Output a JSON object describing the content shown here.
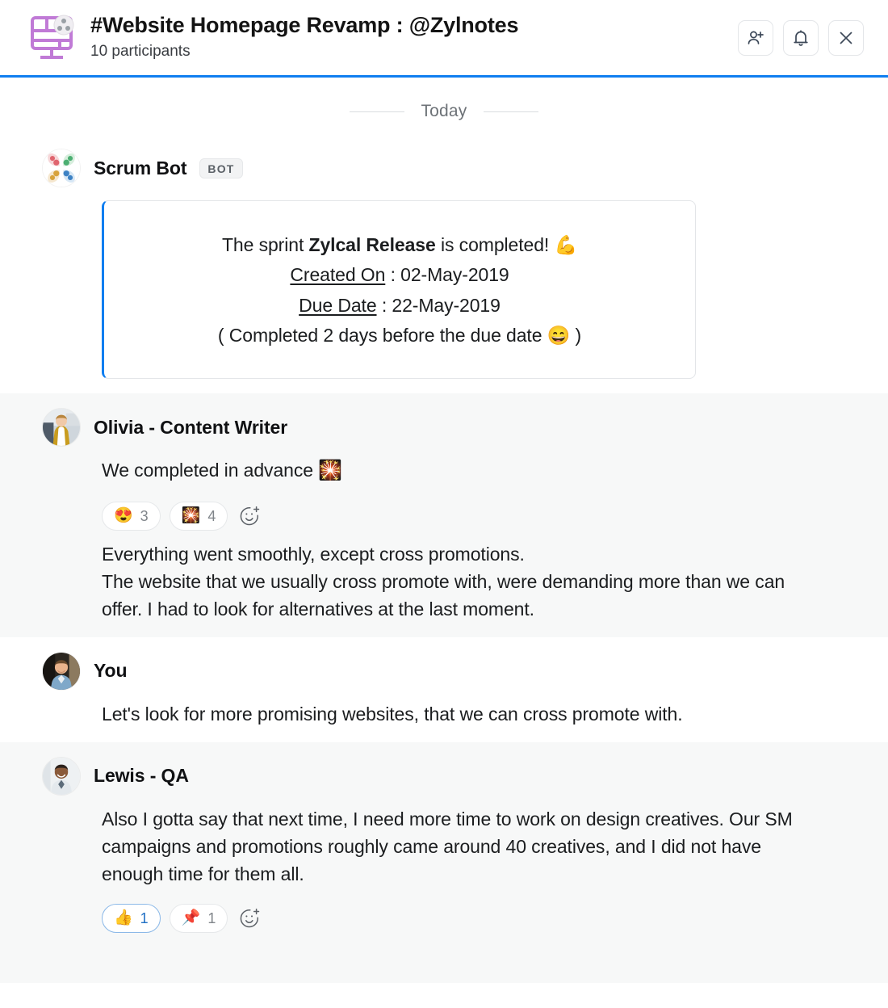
{
  "header": {
    "logo_icon": "wireframe-layout-icon",
    "title": "#Website Homepage Revamp : @Zylnotes",
    "participants": "10 participants",
    "actions": [
      {
        "name": "add-person-icon",
        "label": "Add people"
      },
      {
        "name": "bell-icon",
        "label": "Notifications"
      },
      {
        "name": "close-icon",
        "label": "Close"
      }
    ],
    "accent_color": "#0f7ef0"
  },
  "divider": {
    "label": "Today"
  },
  "messages": [
    {
      "author": "Scrum Bot",
      "badge": "BOT",
      "avatar_icon": "pinwheel-logo-avatar",
      "card": {
        "line1_pre": "The sprint ",
        "line1_bold": "Zylcal Release",
        "line1_post": " is completed! ",
        "line1_emoji": "💪",
        "line2_label": "Created On",
        "line2_value": " : 02-May-2019",
        "line3_label": "Due Date",
        "line3_value": " : 22-May-2019",
        "line4_pre": "( Completed 2 days before the due date ",
        "line4_emoji": "😄",
        "line4_post": " )"
      }
    },
    {
      "author": "Olivia - Content Writer",
      "avatar_icon": "olivia-avatar",
      "text_1": "We completed in advance ",
      "text_1_emoji": "🎇",
      "reactions": [
        {
          "name": "reaction-heart-eyes",
          "emoji": "😍",
          "count": "3",
          "active": false
        },
        {
          "name": "reaction-sparkler",
          "emoji": "🎇",
          "count": "4",
          "active": false
        }
      ],
      "add_reaction_icon": "add-reaction-icon",
      "text_2": "Everything went smoothly, except cross promotions.",
      "text_3": "The website that we usually cross promote with, were demanding more than we can offer. I had to look for alternatives at the last moment."
    },
    {
      "author": "You",
      "avatar_icon": "you-avatar",
      "text_1": "Let's look for more promising websites, that we can cross promote with."
    },
    {
      "author": "Lewis - QA",
      "avatar_icon": "lewis-avatar",
      "text_1": "Also I gotta say that next time, I need more time to work on design creatives. Our SM campaigns and promotions roughly came around 40 creatives, and I did not have enough time for them all.",
      "reactions": [
        {
          "name": "reaction-thumbs-up",
          "emoji": "👍",
          "count": "1",
          "active": true
        },
        {
          "name": "reaction-pushpin",
          "emoji": "📌",
          "count": "1",
          "active": false
        }
      ],
      "add_reaction_icon": "add-reaction-icon"
    }
  ]
}
